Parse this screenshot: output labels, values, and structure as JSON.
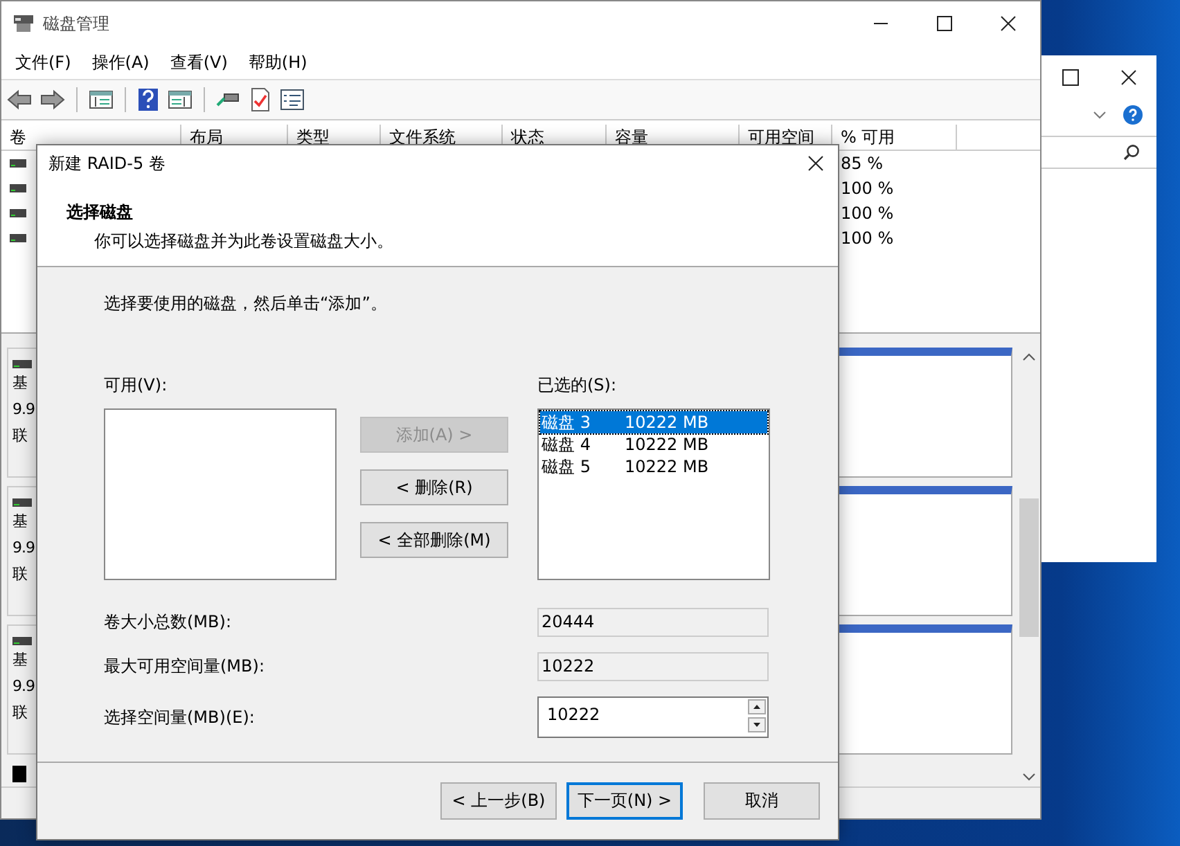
{
  "main_window": {
    "title": "磁盘管理",
    "menu": [
      "文件(F)",
      "操作(A)",
      "查看(V)",
      "帮助(H)"
    ],
    "volume_list": {
      "columns": [
        "卷",
        "布局",
        "类型",
        "文件系统",
        "状态",
        "容量",
        "可用空间",
        "% 可用"
      ],
      "rows": [
        {
          "percent_free": "85 %"
        },
        {
          "percent_free": "100 %"
        },
        {
          "percent_free": "100 %"
        },
        {
          "percent_free": "100 %"
        }
      ]
    },
    "disk_panel": {
      "disks": [
        {
          "line_1": "基",
          "line_2": "9.9",
          "line_3": "联"
        },
        {
          "line_1": "基",
          "line_2": "9.9",
          "line_3": "联"
        },
        {
          "line_1": "基",
          "line_2": "9.9",
          "line_3": "联"
        }
      ]
    }
  },
  "dialog": {
    "title": "新建 RAID-5 卷",
    "heading": "选择磁盘",
    "subheading": "你可以选择磁盘并为此卷设置磁盘大小。",
    "instruction": "选择要使用的磁盘，然后单击“添加”。",
    "available": {
      "label": "可用(V):"
    },
    "selected_disks": {
      "label": "已选的(S):",
      "items": [
        {
          "disk": "磁盘 3",
          "size": "10222 MB",
          "selected": true
        },
        {
          "disk": "磁盘 4",
          "size": "10222 MB",
          "selected": false
        },
        {
          "disk": "磁盘 5",
          "size": "10222 MB",
          "selected": false
        }
      ]
    },
    "move_buttons": [
      {
        "label": "添加(A) >",
        "disabled": true
      },
      {
        "label": "< 删除(R)",
        "disabled": false
      },
      {
        "label": "< 全部删除(M)",
        "disabled": false
      }
    ],
    "fields": [
      {
        "label": "卷大小总数(MB):",
        "value": "20444",
        "kind": "readonly"
      },
      {
        "label": "最大可用空间量(MB):",
        "value": "10222",
        "kind": "readonly"
      },
      {
        "label": "选择空间量(MB)(E):",
        "value": "10222",
        "kind": "spin"
      }
    ],
    "footer_buttons": [
      {
        "label": "< 上一步(B)",
        "default": false
      },
      {
        "label": "下一页(N) >",
        "default": true
      },
      {
        "label": "取消",
        "default": false
      }
    ]
  }
}
